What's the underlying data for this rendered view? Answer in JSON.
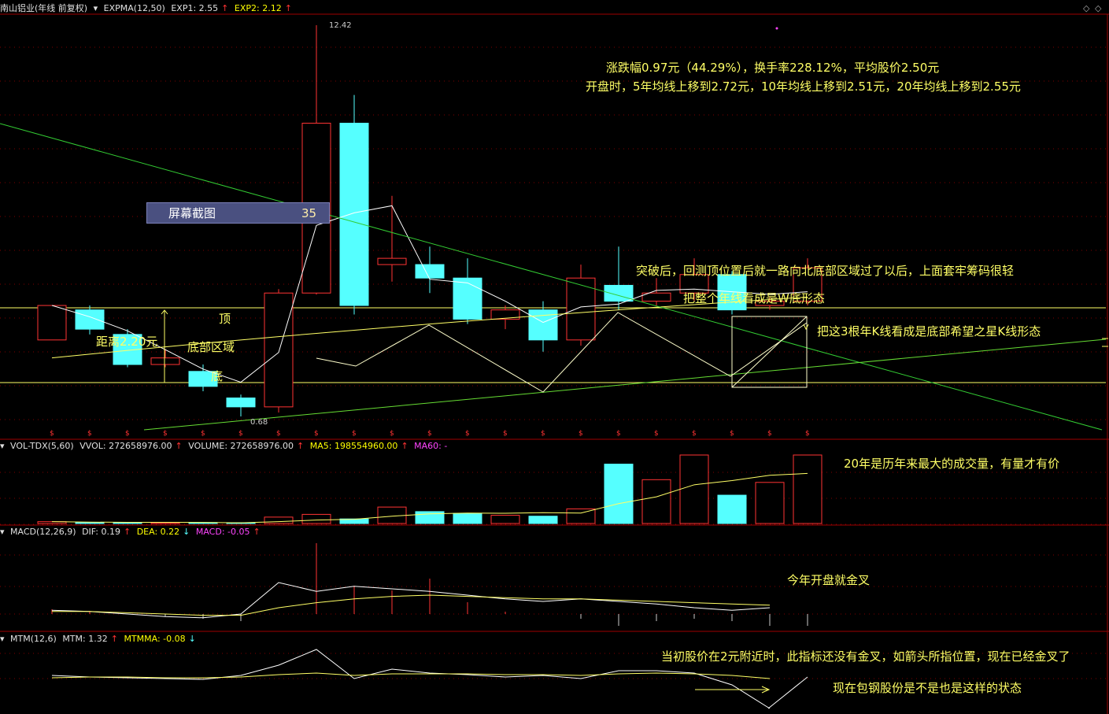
{
  "main_header": {
    "stock": "南山铝业(年线 前复权)",
    "indicator": "EXPMA(12,50)",
    "exp1": "EXP1: 2.55",
    "exp2": "EXP2: 2.12",
    "arrow_up": "↑",
    "arrow_down": "↓"
  },
  "vol_header": {
    "name": "VOL-TDX(5,60)",
    "vvol": "VVOL: 272658976.00",
    "volume": "VOLUME: 272658976.00",
    "ma5": "MA5: 198554960.00",
    "ma60": "MA60: -"
  },
  "macd_header": {
    "name": "MACD(12,26,9)",
    "dif": "DIF: 0.19",
    "dea": "DEA: 0.22",
    "macd": "MACD: -0.05"
  },
  "mtm_header": {
    "name": "MTM(12,6)",
    "mtm": "MTM: 1.32",
    "mtmma": "MTMMA: -0.08"
  },
  "price_labels": {
    "high": "12.42",
    "low": "0.68"
  },
  "annotations": {
    "rise": "涨跌幅0.97元（44.29%），换手率228.12%，平均股价2.50元",
    "open_ma": "开盘时，5年均线上移到2.72元，10年均线上移到2.51元，20年均线上移到2.55元",
    "breakout": "突破后，回测顶位置后就一路向北底部区域过了以后，上面套牢筹码很轻",
    "w_bottom": "把整个年线看成是W底形态",
    "star": "把这3根年K线看成是底部希望之星K线形态",
    "distance": "距离2.20元",
    "top": "顶",
    "bottom_zone": "底部区域",
    "bottom": "底",
    "vol_note": "20年是历年来最大的成交量，有量才有价",
    "macd_note": "今年开盘就金叉",
    "mtm_note1": "当初股价在2元附近时，此指标还没有金叉，如箭头所指位置，现在已经金叉了",
    "mtm_note2": "现在包钢股份是不是也是这样的状态"
  },
  "popup": {
    "label": "屏幕截图",
    "value": "35"
  },
  "controls": {
    "diamond1": "◇",
    "diamond2": "◇"
  },
  "colors": {
    "up": "#ff3333",
    "down": "#55ffff",
    "ma_white": "#ffffff",
    "ma_yellow": "#ffff66",
    "trend": "#33cc33",
    "grid": "#800000"
  },
  "candles": [
    {
      "o": 1.2,
      "c": 1.55,
      "h": 1.55,
      "l": 1.2
    },
    {
      "o": 1.5,
      "c": 1.3,
      "h": 1.55,
      "l": 1.25
    },
    {
      "o": 1.25,
      "c": 1.0,
      "h": 1.3,
      "l": 0.98
    },
    {
      "o": 1.0,
      "c": 1.05,
      "h": 1.12,
      "l": 0.98
    },
    {
      "o": 0.95,
      "c": 0.85,
      "h": 1.0,
      "l": 0.82
    },
    {
      "o": 0.78,
      "c": 0.73,
      "h": 0.8,
      "l": 0.68
    },
    {
      "o": 0.73,
      "c": 1.7,
      "h": 1.75,
      "l": 0.7
    },
    {
      "o": 1.7,
      "c": 6.0,
      "h": 12.42,
      "l": 1.68
    },
    {
      "o": 6.0,
      "c": 1.55,
      "h": 7.4,
      "l": 1.45
    },
    {
      "o": 2.1,
      "c": 2.2,
      "h": 3.5,
      "l": 1.85
    },
    {
      "o": 2.1,
      "c": 1.9,
      "h": 2.4,
      "l": 1.7
    },
    {
      "o": 1.9,
      "c": 1.4,
      "h": 2.2,
      "l": 1.35
    },
    {
      "o": 1.4,
      "c": 1.5,
      "h": 1.55,
      "l": 1.3
    },
    {
      "o": 1.5,
      "c": 1.2,
      "h": 1.6,
      "l": 1.1
    },
    {
      "o": 1.2,
      "c": 1.9,
      "h": 2.1,
      "l": 1.15
    },
    {
      "o": 1.8,
      "c": 1.6,
      "h": 2.4,
      "l": 1.5
    },
    {
      "o": 1.6,
      "c": 1.7,
      "h": 1.9,
      "l": 1.55
    },
    {
      "o": 1.7,
      "c": 1.95,
      "h": 2.2,
      "l": 1.6
    },
    {
      "o": 1.95,
      "c": 1.5,
      "h": 2.0,
      "l": 1.45
    },
    {
      "o": 1.55,
      "c": 1.6,
      "h": 1.65,
      "l": 1.5
    },
    {
      "o": 1.6,
      "c": 2.05,
      "h": 2.2,
      "l": 1.55
    }
  ],
  "volume": [
    0.02,
    0.01,
    0.01,
    0.01,
    0.01,
    0.0,
    0.07,
    0.1,
    0.05,
    0.18,
    0.13,
    0.11,
    0.09,
    0.08,
    0.16,
    0.65,
    0.48,
    0.75,
    0.31,
    0.45,
    0.75
  ],
  "macd_bars": [
    0.02,
    0.01,
    0.0,
    -0.01,
    -0.02,
    -0.03,
    0.0,
    0.3,
    0.12,
    0.1,
    0.15,
    0.05,
    0.01,
    0.0,
    -0.02,
    -0.05,
    -0.03,
    -0.02,
    -0.03,
    -0.05,
    -0.05
  ]
}
